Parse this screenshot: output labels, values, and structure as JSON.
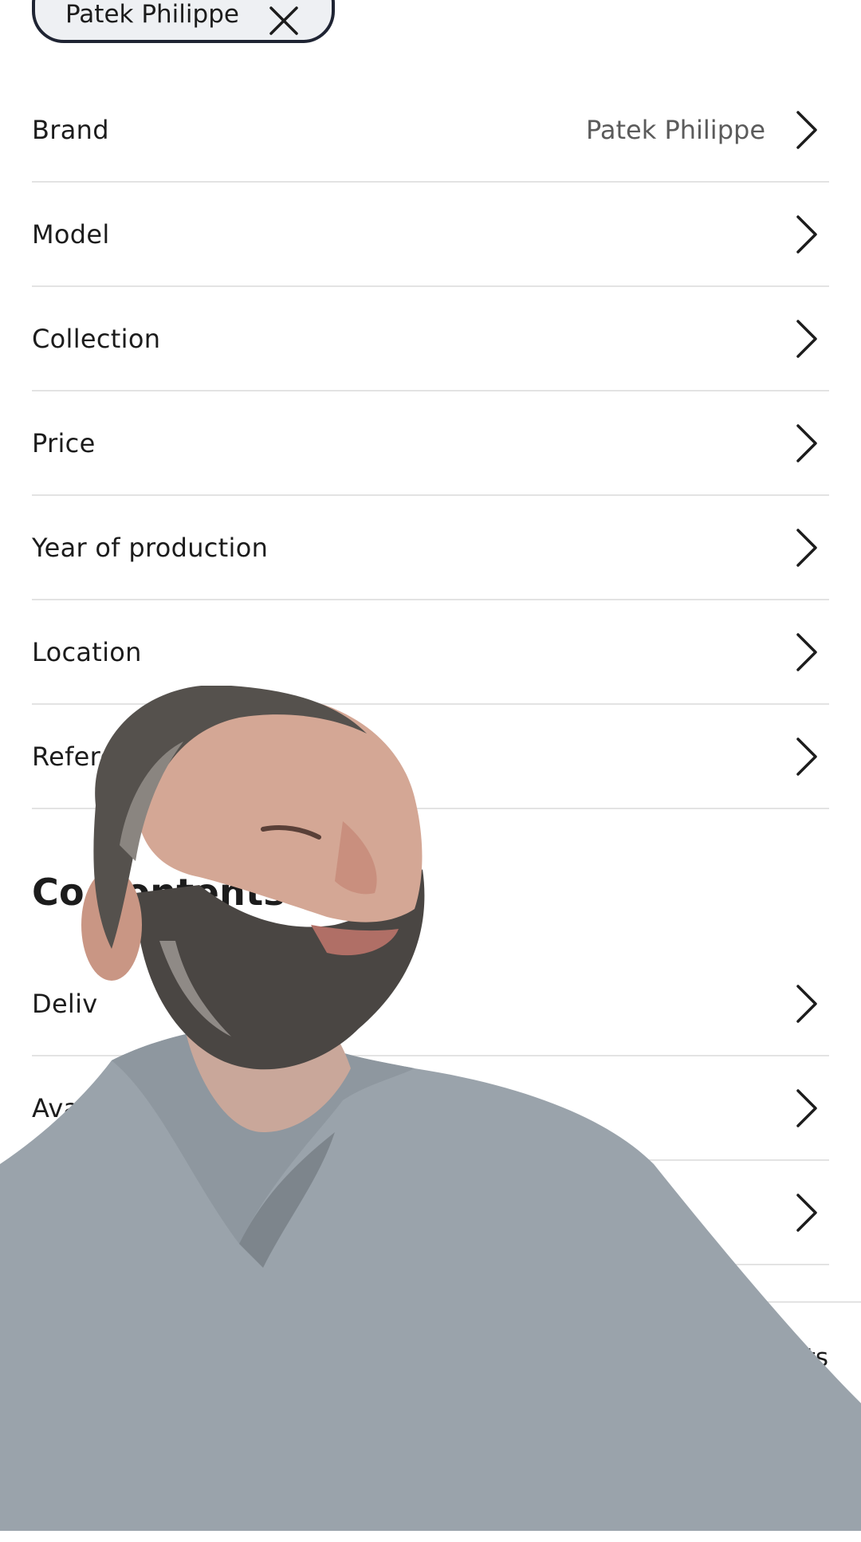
{
  "filter_chip": {
    "label": "Patek Philippe"
  },
  "filter_rows": [
    {
      "label": "Brand",
      "value": "Patek Philippe"
    },
    {
      "label": "Model",
      "value": ""
    },
    {
      "label": "Collection",
      "value": ""
    },
    {
      "label": "Price",
      "value": ""
    },
    {
      "label": "Year of production",
      "value": ""
    },
    {
      "label": "Location",
      "value": ""
    },
    {
      "label": "Reference",
      "value": ""
    }
  ],
  "section": {
    "title": "Co Contents"
  },
  "section_rows": [
    {
      "label": "Deliv"
    },
    {
      "label": "Avail"
    },
    {
      "label": ""
    }
  ],
  "bottom_bar": {
    "results_label_fragment": "lts"
  },
  "colors": {
    "chip_border": "#1f2433",
    "chip_background": "#eef0f3",
    "divider": "#e3e3e3",
    "secondary_text": "#5b5b5b"
  },
  "icons": {
    "chip_close": "close-icon",
    "row_chevron": "chevron-right-icon"
  }
}
